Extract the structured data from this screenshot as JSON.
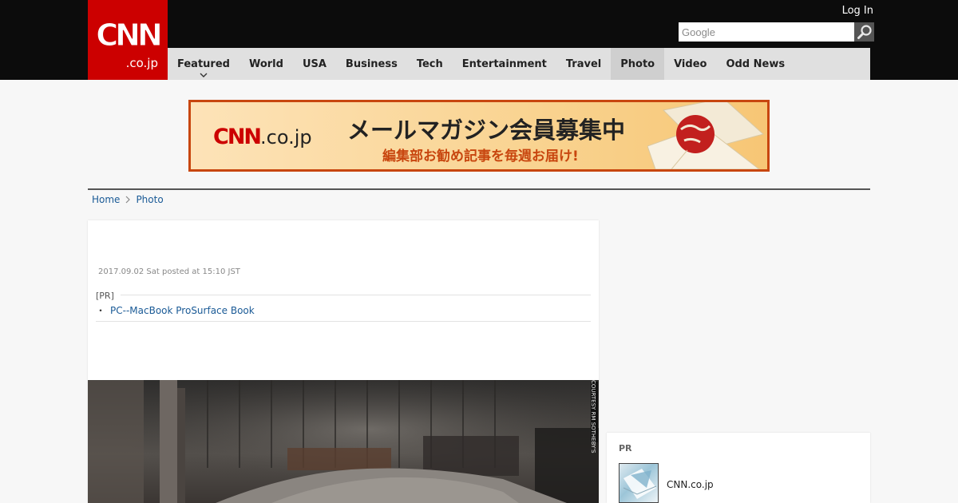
{
  "header": {
    "logo_main": "CNN",
    "logo_sub": ".co.jp",
    "login_label": "Log In",
    "search_placeholder": "Google"
  },
  "nav": {
    "items": [
      {
        "label": "Featured",
        "has_dropdown": true
      },
      {
        "label": "World"
      },
      {
        "label": "USA"
      },
      {
        "label": "Business"
      },
      {
        "label": "Tech"
      },
      {
        "label": "Entertainment"
      },
      {
        "label": "Travel"
      },
      {
        "label": "Photo",
        "active": true
      },
      {
        "label": "Video"
      },
      {
        "label": "Odd News"
      }
    ]
  },
  "banner": {
    "logo_main": "CNN",
    "logo_sub": ".co.jp",
    "title": "メールマガジン会員募集中",
    "subtitle": "編集部お勧め記事を毎週お届け!"
  },
  "breadcrumb": {
    "items": [
      "Home",
      "Photo"
    ]
  },
  "article": {
    "posted": "2017.09.02 Sat posted at 15:10 JST",
    "pr_label": "[PR]",
    "pr_bullet": "・",
    "pr_link": "PC--MacBook ProSurface Book",
    "photo_credit": "COURTESY RM SOTHEBY'S"
  },
  "sidebar": {
    "pr_heading": "PR",
    "pr_item_text": "CNN.co.jp"
  },
  "colors": {
    "brand_red": "#cc0000",
    "header_bg": "#0c0c0c",
    "nav_bg": "#e0e0e0",
    "link_blue": "#1a5a96",
    "banner_border": "#c8460f"
  }
}
